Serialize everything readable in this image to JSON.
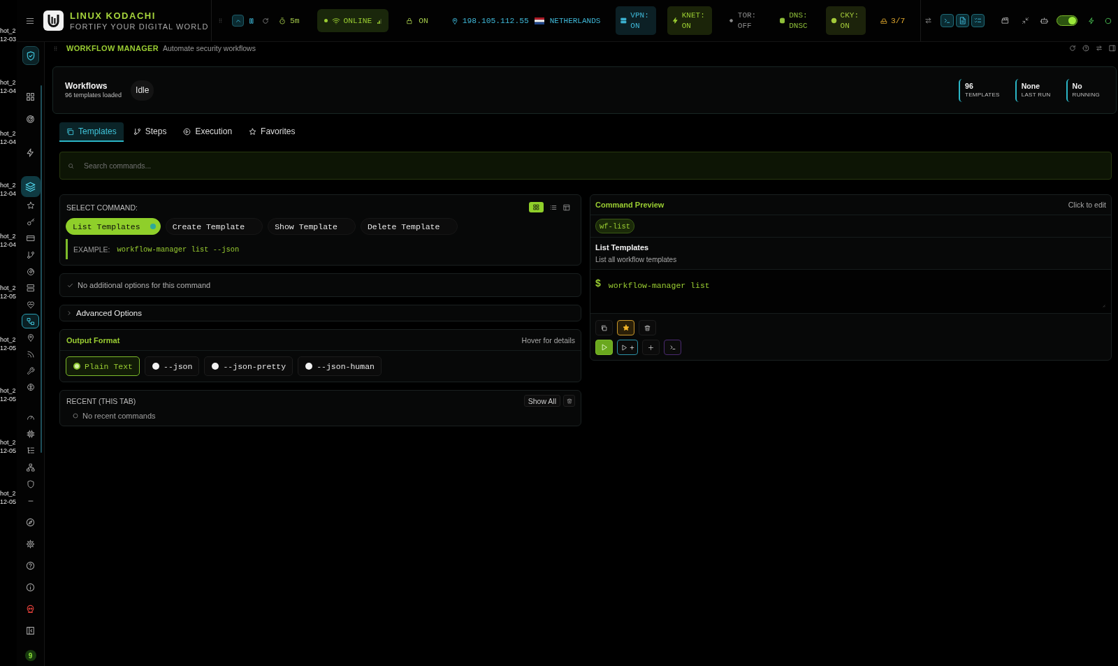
{
  "desktop": {
    "files": [
      {
        "name": "hot_2",
        "date": "12-03"
      },
      {
        "name": "hot_2",
        "date": "12-04"
      },
      {
        "name": "hot_2",
        "date": "12-04"
      },
      {
        "name": "hot_2",
        "date": "12-04"
      },
      {
        "name": "hot_2",
        "date": "12-04"
      },
      {
        "name": "hot_2",
        "date": "12-05"
      },
      {
        "name": "hot_2",
        "date": "12-05"
      },
      {
        "name": "hot_2",
        "date": "12-05"
      },
      {
        "name": "hot_2",
        "date": "12-05"
      },
      {
        "name": "hot_2",
        "date": "12-05"
      }
    ]
  },
  "topbar": {
    "brand": {
      "title": "LINUX KODACHI",
      "tagline": "FORTIFY YOUR DIGITAL WORLD"
    },
    "tools": [
      {
        "selected": true
      },
      {
        "selected": false
      },
      {
        "selected": false
      }
    ],
    "timer": "5m",
    "network": {
      "label": "ONLINE",
      "online": true
    },
    "lock": "ON",
    "ip": "198.105.112.55",
    "country": "NETHERLANDS",
    "services": [
      {
        "label": "VPN:",
        "value": "ON",
        "color": "#3fb8d8",
        "highlighted": true
      },
      {
        "label": "KNET:",
        "value": "ON",
        "color": "#9acd32",
        "highlighted": true
      },
      {
        "label": "TOR:",
        "value": "OFF",
        "color": "#8a8a8a",
        "highlighted": false
      },
      {
        "label": "DNS:",
        "value": "DNSC",
        "color": "#8fbf3a",
        "highlighted": false
      },
      {
        "label": "CKY:",
        "value": "ON",
        "color": "#a3c93a",
        "highlighted": true
      }
    ],
    "slots": "3/7",
    "actions": [
      {
        "selected": false
      },
      {
        "selected": true
      },
      {
        "selected": true
      },
      {
        "selected": true
      },
      {
        "selected": false
      },
      {
        "selected": false
      },
      {
        "selected": false
      }
    ],
    "toggle": {
      "on": true
    }
  },
  "sidebar": {
    "groups": [
      [
        {
          "kind": "brand",
          "selected": false
        }
      ],
      [
        {
          "kind": "link",
          "selected": false
        },
        {
          "kind": "link",
          "selected": false
        }
      ],
      [
        {
          "kind": "link",
          "selected": false
        }
      ],
      [
        {
          "kind": "section",
          "selected": true
        },
        {
          "kind": "link",
          "selected": false
        },
        {
          "kind": "link",
          "selected": false
        },
        {
          "kind": "link",
          "selected": false
        },
        {
          "kind": "link",
          "selected": false
        },
        {
          "kind": "link",
          "selected": false
        },
        {
          "kind": "link",
          "selected": false
        },
        {
          "kind": "link",
          "selected": false
        },
        {
          "kind": "link",
          "selected": true
        },
        {
          "kind": "link",
          "selected": false
        },
        {
          "kind": "link",
          "selected": false
        },
        {
          "kind": "link",
          "selected": false
        },
        {
          "kind": "link",
          "selected": false
        }
      ],
      [
        {
          "kind": "link",
          "selected": false
        },
        {
          "kind": "link",
          "selected": false
        },
        {
          "kind": "link",
          "selected": false
        },
        {
          "kind": "link",
          "selected": false
        },
        {
          "kind": "link",
          "selected": false
        },
        {
          "kind": "link",
          "selected": false
        }
      ],
      [
        {
          "kind": "link",
          "selected": false
        },
        {
          "kind": "link",
          "selected": false
        },
        {
          "kind": "link",
          "selected": false
        },
        {
          "kind": "link",
          "selected": false
        },
        {
          "kind": "danger",
          "selected": false
        },
        {
          "kind": "link",
          "selected": false
        }
      ]
    ],
    "badge": "9"
  },
  "panel": {
    "title": "WORKFLOW MANAGER",
    "subtitle": "Automate security workflows"
  },
  "summary": {
    "title": "Workflows",
    "subtitle": "96 templates loaded",
    "status": "Idle",
    "stats": [
      {
        "value": "96",
        "label": "TEMPLATES"
      },
      {
        "value": "None",
        "label": "LAST RUN"
      },
      {
        "value": "No",
        "label": "RUNNING"
      }
    ]
  },
  "tabs": [
    {
      "label": "Templates",
      "selected": true
    },
    {
      "label": "Steps",
      "selected": false
    },
    {
      "label": "Execution",
      "selected": false
    },
    {
      "label": "Favorites",
      "selected": false
    }
  ],
  "search": {
    "placeholder": "Search commands..."
  },
  "select_command": {
    "heading": "SELECT COMMAND:",
    "views": [
      {
        "selected": true
      },
      {
        "selected": false
      },
      {
        "selected": false
      }
    ],
    "commands": [
      {
        "label": "List Templates",
        "selected": true
      },
      {
        "label": "Create Template",
        "selected": false
      },
      {
        "label": "Show Template",
        "selected": false
      },
      {
        "label": "Delete Template",
        "selected": false
      }
    ],
    "example": {
      "label": "EXAMPLE:",
      "code": "workflow-manager list --json"
    }
  },
  "options": {
    "note": "No additional options for this command"
  },
  "advanced": {
    "label": "Advanced Options",
    "expanded": false
  },
  "output_format": {
    "title": "Output Format",
    "hint": "Hover for details",
    "options": [
      {
        "label": "Plain Text",
        "selected": true
      },
      {
        "label": "--json",
        "selected": false
      },
      {
        "label": "--json-pretty",
        "selected": false
      },
      {
        "label": "--json-human",
        "selected": false
      }
    ]
  },
  "recent": {
    "title": "RECENT (THIS TAB)",
    "show_all": "Show All",
    "empty": "No recent commands"
  },
  "preview": {
    "title": "Command Preview",
    "hint": "Click to edit",
    "alias": "wf-list",
    "name": "List Templates",
    "description": "List all workflow templates",
    "prompt": "$",
    "command": "workflow-manager list",
    "favorite": true
  }
}
